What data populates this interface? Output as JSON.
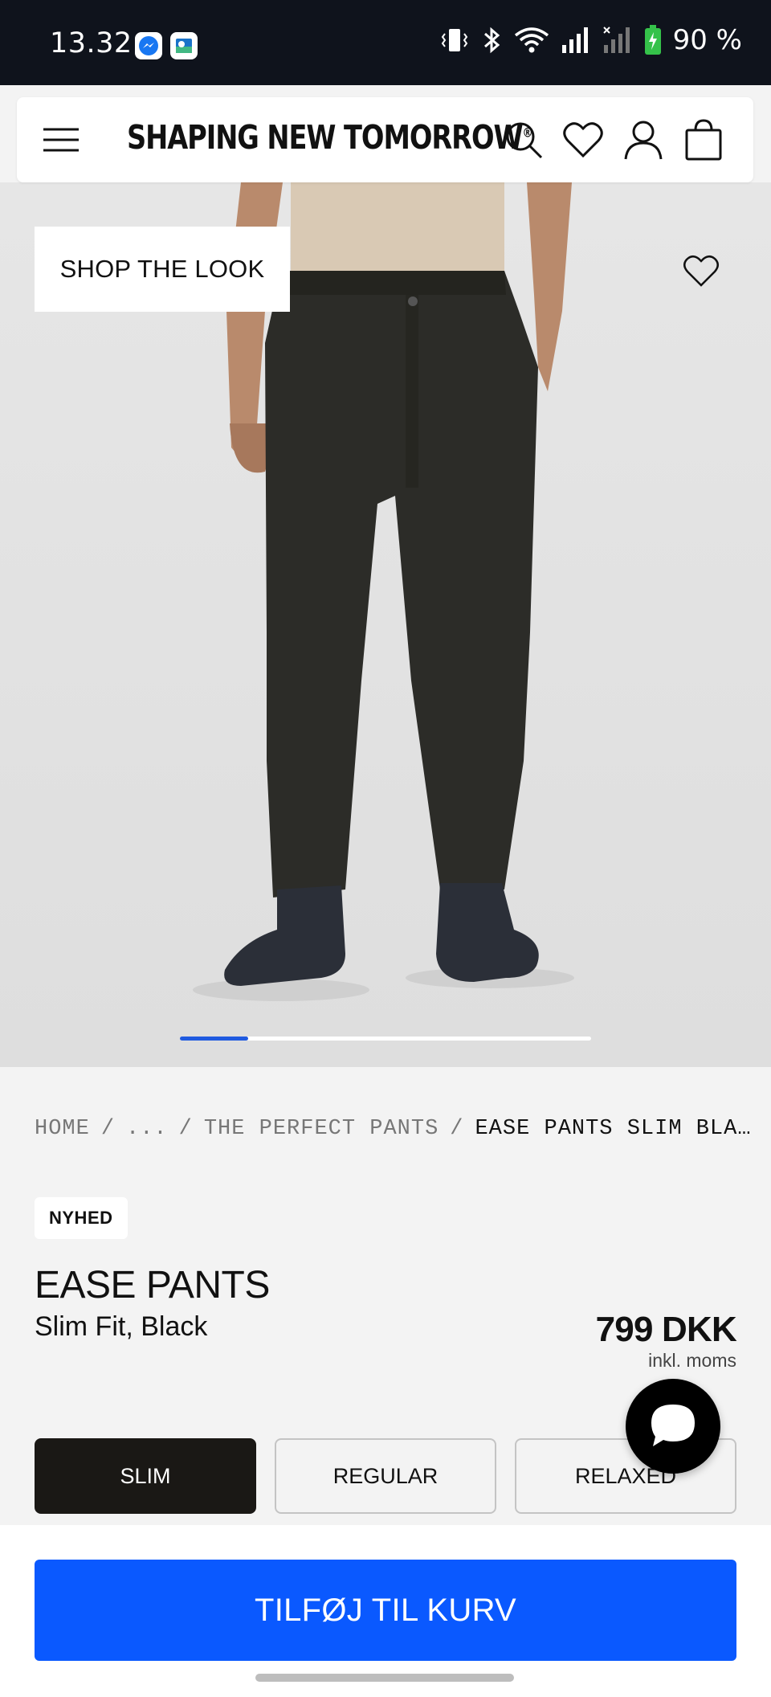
{
  "status_bar": {
    "time": "13.32",
    "battery_percent": "90 %",
    "icons": [
      "messenger-icon",
      "outlook-icon",
      "vibrate-icon",
      "bluetooth-icon",
      "wifi-icon",
      "signal-icon",
      "signal-no-service-icon",
      "battery-charging-icon"
    ]
  },
  "header": {
    "brand": "SHAPING NEW TOMORROW",
    "brand_mark": "®",
    "icons": [
      "menu-icon",
      "search-icon",
      "heart-icon",
      "user-icon",
      "bag-icon"
    ]
  },
  "hero": {
    "shop_the_look_label": "SHOP THE LOOK",
    "carousel_progress": 0.166
  },
  "breadcrumb": {
    "items": [
      "HOME",
      "...",
      "THE PERFECT PANTS"
    ],
    "separator": "/",
    "current": "EASE PANTS SLIM BLA…"
  },
  "product": {
    "badge": "NYHED",
    "name": "EASE PANTS",
    "variant": "Slim Fit, Black",
    "price": "799 DKK",
    "vat_note": "inkl. moms"
  },
  "fits": {
    "options": [
      "SLIM",
      "REGULAR",
      "RELAXED"
    ],
    "selected_index": 0
  },
  "cta": {
    "add_to_cart_label": "TILFØJ TIL KURV"
  },
  "colors": {
    "accent": "#0a59ff",
    "carousel_indicator": "#1f5ae0",
    "active_fit_bg": "#1a1815",
    "status_bar_bg": "#0f131c"
  }
}
